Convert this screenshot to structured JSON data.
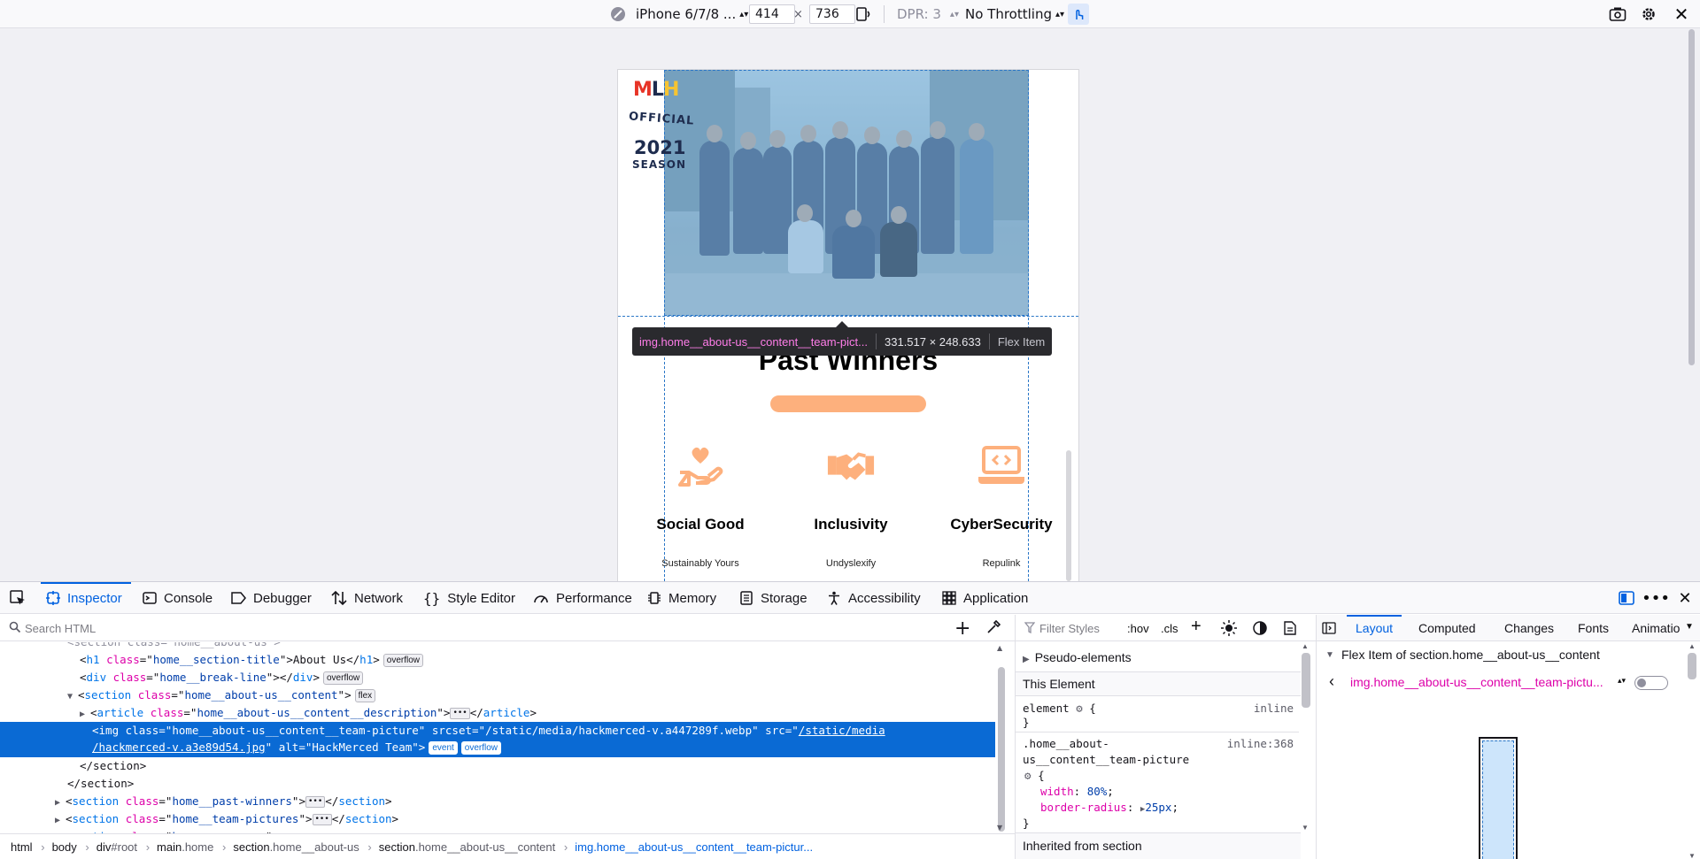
{
  "toolbar": {
    "device": "iPhone 6/7/8 ...",
    "width": "414",
    "times": "×",
    "height": "736",
    "dpr": "DPR: 3",
    "throttling": "No Throttling",
    "icons": [
      "device-mode-icon",
      "rotate-icon",
      "touch-simulation-icon",
      "screenshot-icon",
      "settings-icon",
      "close-icon"
    ]
  },
  "page": {
    "badge": {
      "logo": "MLH",
      "official": "OFFICIAL",
      "year": "2021",
      "season": "SEASON"
    },
    "section_title": "Past Winners",
    "winners": [
      {
        "category": "Social Good",
        "name": "Sustainably Yours",
        "icon": "heart-in-hand-icon"
      },
      {
        "category": "Inclusivity",
        "name": "Undyslexify",
        "icon": "handshake-icon"
      },
      {
        "category": "CyberSecurity",
        "name": "Repulink",
        "icon": "laptop-code-icon"
      }
    ],
    "accent_color": "#fdb07d"
  },
  "infobar": {
    "tag": "img.home__about-us__content__team-pict...",
    "dims": "331.517 × 248.633",
    "type": "Flex Item"
  },
  "devtools": {
    "tabs": [
      {
        "label": "Inspector",
        "icon": "inspector-icon",
        "active": true
      },
      {
        "label": "Console",
        "icon": "console-icon"
      },
      {
        "label": "Debugger",
        "icon": "debugger-icon"
      },
      {
        "label": "Network",
        "icon": "network-icon"
      },
      {
        "label": "Style Editor",
        "icon": "style-editor-icon"
      },
      {
        "label": "Performance",
        "icon": "performance-icon"
      },
      {
        "label": "Memory",
        "icon": "memory-icon"
      },
      {
        "label": "Storage",
        "icon": "storage-icon"
      },
      {
        "label": "Accessibility",
        "icon": "accessibility-icon"
      },
      {
        "label": "Application",
        "icon": "application-icon"
      }
    ],
    "search_placeholder": "Search HTML",
    "tree": {
      "l0": "<section class=\"home__about-us\">",
      "l1_tag": "h1",
      "l1_class": "home__section-title",
      "l1_text": "About Us",
      "l1_badge": "overflow",
      "l2_tag": "div",
      "l2_class": "home__break-line",
      "l2_badge": "overflow",
      "l3_tag": "section",
      "l3_class": "home__about-us__content",
      "l3_badge": "flex",
      "l4_tag": "article",
      "l4_class": "home__about-us__content__description",
      "l5_class": "home__about-us__content__team-picture",
      "l5_srcset": "/static/media/hackmerced-v.a447289f.webp",
      "l5_src_a": "/static/media",
      "l5_src_b": "/hackmerced-v.a3e89d54.jpg",
      "l5_alt": "HackMerced Team",
      "l5_badge1": "event",
      "l5_badge2": "overflow",
      "l6": "</section>",
      "l7": "</section>",
      "l8_class": "home__past-winners",
      "l9_class": "home__team-pictures",
      "l10_class": "home__sponsors"
    },
    "breadcrumbs": [
      {
        "tag": "html",
        "cls": ""
      },
      {
        "tag": "body",
        "cls": ""
      },
      {
        "tag": "div",
        "cls": "#root"
      },
      {
        "tag": "main",
        "cls": ".home"
      },
      {
        "tag": "section",
        "cls": ".home__about-us"
      },
      {
        "tag": "section",
        "cls": ".home__about-us__content"
      },
      {
        "tag": "img.home__about-us__content__team-pictur...",
        "cls": ""
      }
    ],
    "rules": {
      "filter_placeholder": "Filter Styles",
      "hov": ":hov",
      "cls": ".cls",
      "pseudo": "Pseudo-elements",
      "this_element": "This Element",
      "element_sel": "element",
      "brace_open": "{",
      "brace_close": "}",
      "inline": "inline",
      "selector_a": ".home__about-",
      "selector_b": "us__content__team-picture",
      "origin": "inline:368",
      "p1": "width",
      "v1": "80%",
      "p2": "border-radius",
      "v2": "25px",
      "inherited": "Inherited from section"
    },
    "layout": {
      "tabs": [
        "Layout",
        "Computed",
        "Changes",
        "Fonts",
        "Animatio"
      ],
      "flex_header": "Flex Item of section.home__about-us__content",
      "flex_item": "img.home__about-us__content__team-pictu..."
    }
  }
}
